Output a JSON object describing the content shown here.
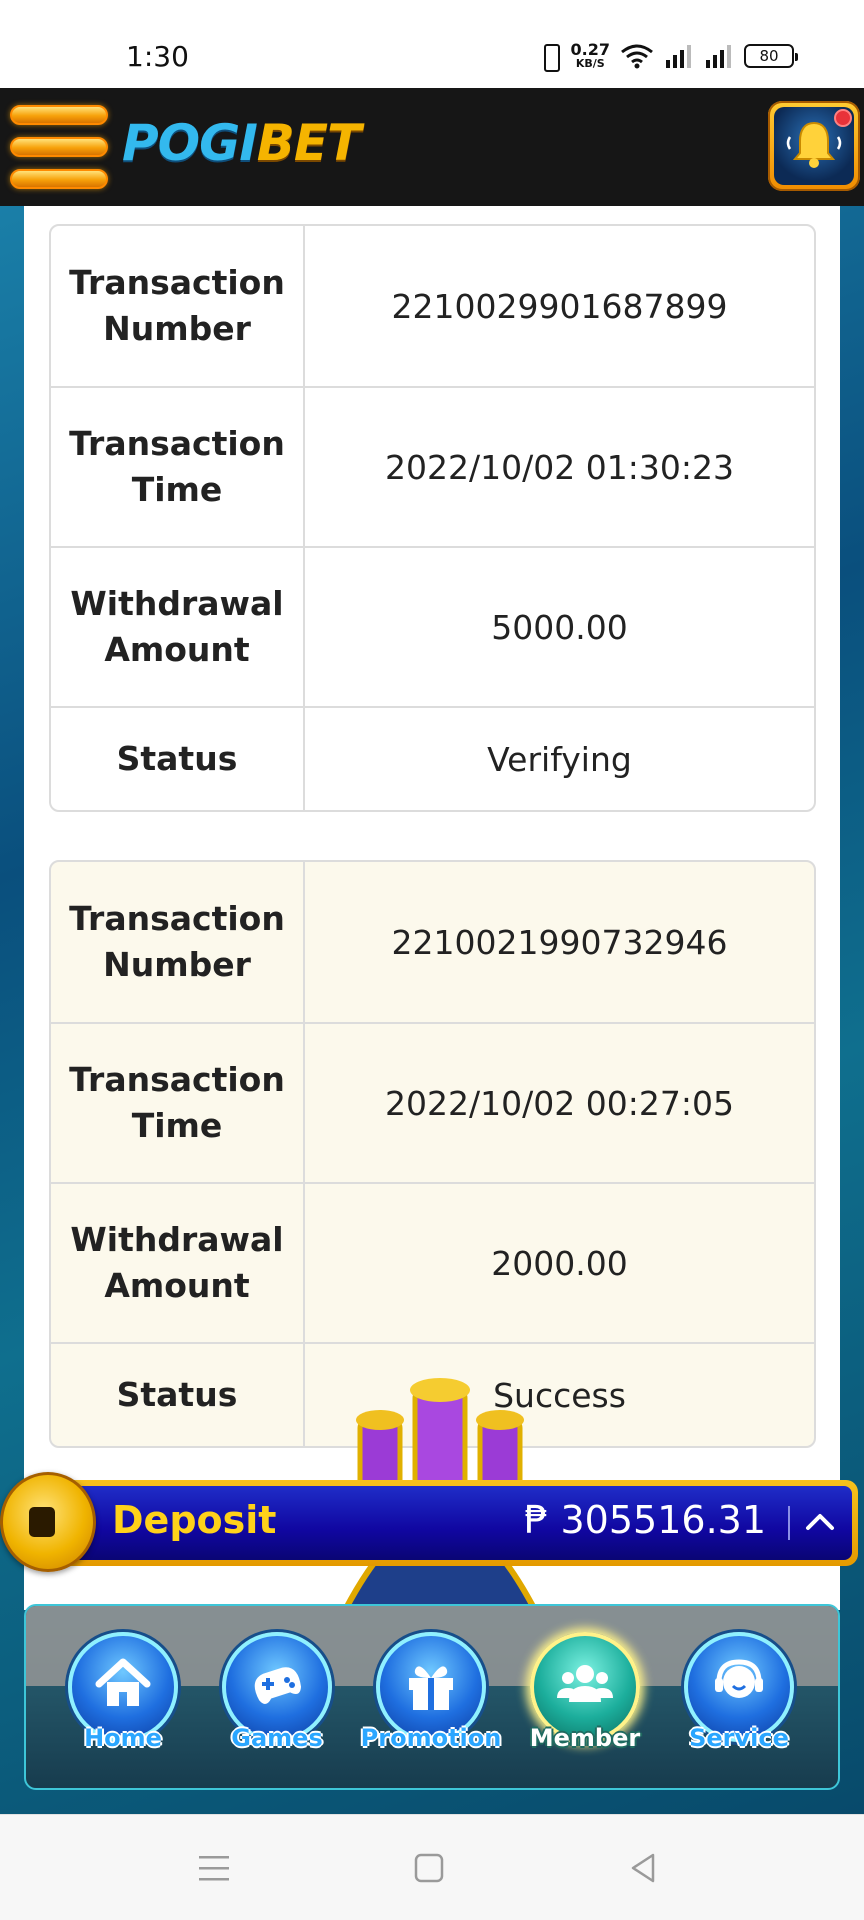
{
  "status_bar": {
    "time": "1:30",
    "net_speed_value": "0.27",
    "net_speed_unit": "KB/S",
    "battery": "80"
  },
  "header": {
    "logo_part1": "POGI",
    "logo_part2": "BET",
    "menu_icon": "hamburger-menu-icon",
    "notification_icon": "bell-icon"
  },
  "transactions": [
    {
      "labels": {
        "number": "Transaction Number",
        "time": "Transaction Time",
        "amount": "Withdrawal Amount",
        "status": "Status"
      },
      "number": "2210029901687899",
      "time": "2022/10/02 01:30:23",
      "amount": "5000.00",
      "status": "Verifying"
    },
    {
      "labels": {
        "number": "Transaction Number",
        "time": "Transaction Time",
        "amount": "Withdrawal Amount",
        "status": "Status"
      },
      "number": "2210021990732946",
      "time": "2022/10/02 00:27:05",
      "amount": "2000.00",
      "status": "Success"
    }
  ],
  "deposit": {
    "label": "Deposit",
    "amount": "₱ 305516.31",
    "toggle_icon": "chevron-up-icon"
  },
  "bottom_nav": {
    "items": [
      {
        "label": "Home",
        "icon": "home-icon"
      },
      {
        "label": "Games",
        "icon": "gamepad-icon"
      },
      {
        "label": "Promotion",
        "icon": "gift-icon"
      },
      {
        "label": "Member",
        "icon": "users-icon",
        "active": true
      },
      {
        "label": "Service",
        "icon": "headset-icon"
      }
    ]
  },
  "colors": {
    "header_bg": "#161616",
    "deposit_bg": "#1006a0",
    "deposit_label": "#ffd21a",
    "table_alt_bg": "#fcf9ec"
  }
}
